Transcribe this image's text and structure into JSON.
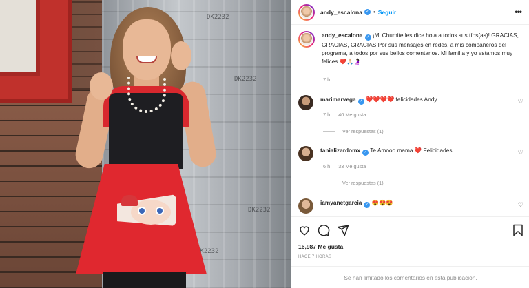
{
  "post": {
    "username": "andy_escalona",
    "follow_label": "Seguir",
    "separator": "•",
    "caption_emojis": "❤️🙏🏻🤰🏻",
    "caption": "¡Mi Chumite les dice hola a todos sus tíos(as)! GRACIAS, GRACIAS, GRACIAS Por sus mensajes en redes, a mis compañeros del programa, a todos por sus bellos comentarios. Mi familia y yo estamos muy felices",
    "caption_time": "7 h"
  },
  "comments": [
    {
      "username": "marimarvega",
      "text": "❤️❤️❤️❤️ felicidades Andy",
      "time": "7 h",
      "likes": "40 Me gusta",
      "replies_label": "Ver respuestas (1)"
    },
    {
      "username": "tanializardomx",
      "text_before": "Te Amooo mama",
      "text_heart": "❤️",
      "text_after": "Felicidades",
      "time": "6 h",
      "likes": "33 Me gusta",
      "replies_label": "Ver respuestas (1)"
    },
    {
      "username": "iamyanetgarcia",
      "text": "😍😍😍"
    }
  ],
  "engagement": {
    "likes": "16,987 Me gusta",
    "time_ago": "HACE 7 HORAS"
  },
  "footer": {
    "disabled_comments": "Se han limitado los comentarios en esta publicación."
  },
  "icons": {
    "verified": "verified-badge-icon",
    "more": "more-options-icon",
    "like": "heart-icon",
    "comment": "comment-icon",
    "share": "share-icon",
    "save": "bookmark-icon"
  },
  "colors": {
    "accent": "#0095f6",
    "verified": "#3897f0",
    "muted": "#8e8e8e"
  }
}
